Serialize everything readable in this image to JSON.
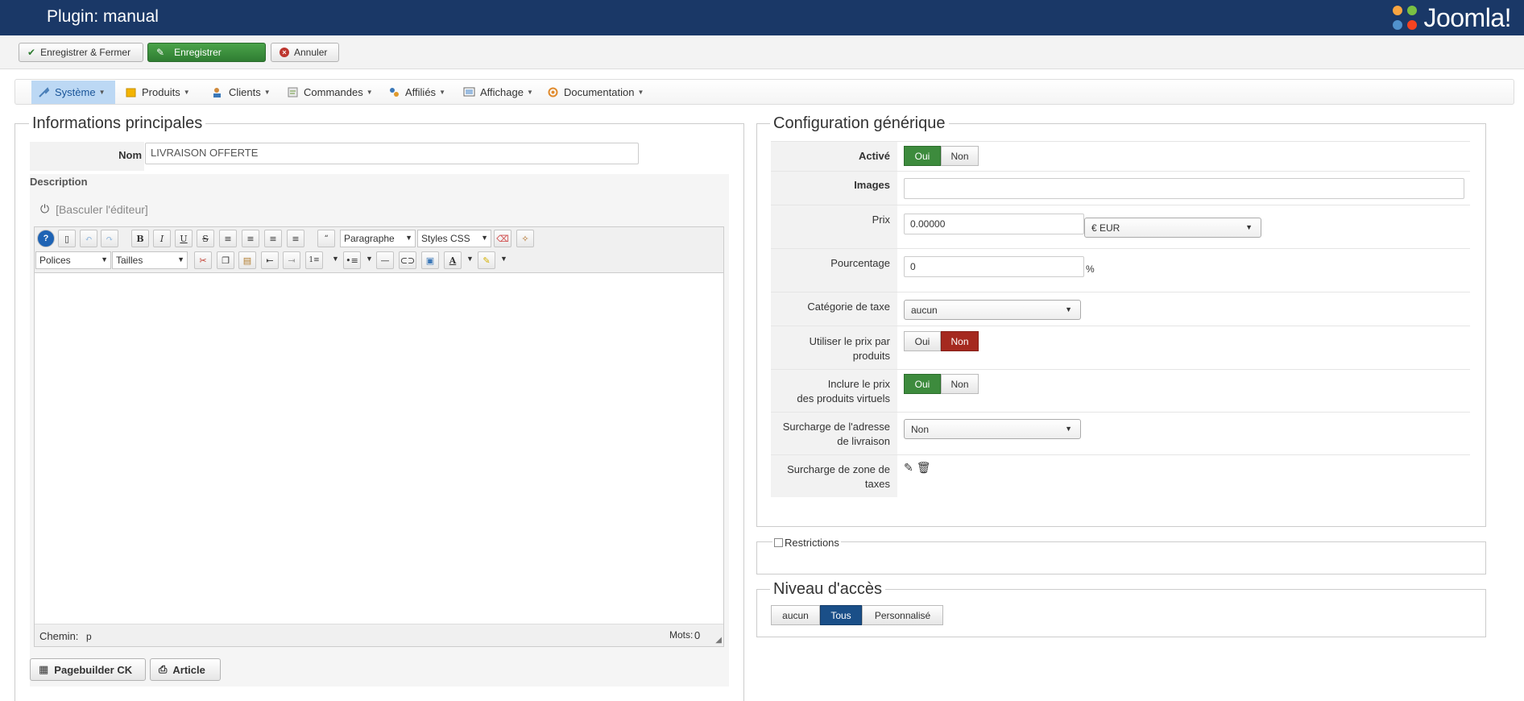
{
  "header": {
    "title": "Plugin: manual",
    "logo_text": "Joomla!"
  },
  "toolbar": {
    "save_close": "Enregistrer & Fermer",
    "save": "Enregistrer",
    "cancel": "Annuler"
  },
  "menu": [
    {
      "label": "Système",
      "icon": "tools-icon"
    },
    {
      "label": "Produits",
      "icon": "box-icon"
    },
    {
      "label": "Clients",
      "icon": "users-icon"
    },
    {
      "label": "Commandes",
      "icon": "orders-icon"
    },
    {
      "label": "Affiliés",
      "icon": "affiliates-icon"
    },
    {
      "label": "Affichage",
      "icon": "display-icon"
    },
    {
      "label": "Documentation",
      "icon": "docs-icon"
    }
  ],
  "main_info": {
    "legend": "Informations principales",
    "nom_label": "Nom",
    "nom_value": "LIVRAISON OFFERTE",
    "description_label": "Description",
    "toggle_editor": "[Basculer l'éditeur]",
    "editor": {
      "format_select": "Paragraphe",
      "styles_select": "Styles CSS",
      "font_select": "Polices",
      "size_select": "Tailles",
      "path_label": "Chemin:",
      "path_value": "p",
      "words_label": "Mots:",
      "words_value": "0"
    },
    "pagebuilder_button": "Pagebuilder CK",
    "article_button": "Article"
  },
  "generic_config": {
    "legend": "Configuration générique",
    "active_label": "Activé",
    "images_label": "Images",
    "price_label": "Prix",
    "price_value": "0.00000",
    "currency_value": "€ EUR",
    "percent_label": "Pourcentage",
    "percent_value": "0",
    "percent_sign": "%",
    "tax_category_label": "Catégorie de taxe",
    "tax_category_value": "aucun",
    "use_product_price_label_1": "Utiliser le prix par",
    "use_product_price_label_2": "produits",
    "include_virtual_label_1": "Inclure le prix",
    "include_virtual_label_2": "des produits virtuels",
    "override_address_label_1": "Surcharge de l'adresse",
    "override_address_label_2": "de livraison",
    "override_address_value": "Non",
    "override_tax_zone_label_1": "Surcharge de zone de",
    "override_tax_zone_label_2": "taxes",
    "yes": "Oui",
    "no": "Non"
  },
  "restrictions": {
    "label": "Restrictions"
  },
  "access": {
    "legend": "Niveau d'accès",
    "options": [
      "aucun",
      "Tous",
      "Personnalisé"
    ]
  },
  "colors": {
    "header_bg": "#1a3867",
    "green": "#3d8b3d",
    "red": "#a5291f",
    "blue": "#1a4f88"
  }
}
